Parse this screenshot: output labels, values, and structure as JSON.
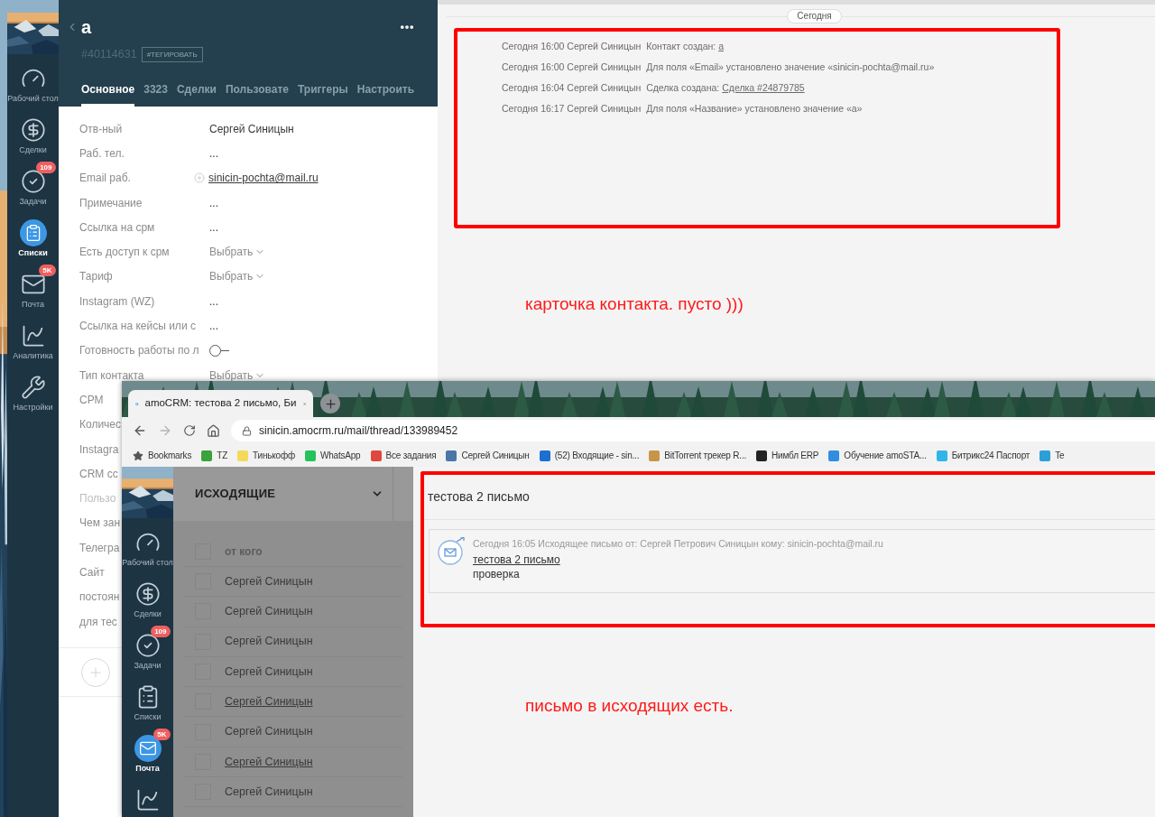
{
  "sidebar": {
    "items": [
      {
        "label": "Рабочий стол",
        "selected": false
      },
      {
        "label": "Сделки",
        "selected": false
      },
      {
        "label": "Задачи",
        "badge": "109",
        "selected": false
      },
      {
        "label": "Списки",
        "selected": true
      },
      {
        "label": "Почта",
        "badge": "5K",
        "selected": false
      },
      {
        "label": "Аналитика",
        "selected": false
      },
      {
        "label": "Настройки",
        "selected": false
      }
    ]
  },
  "contact": {
    "title": "a",
    "id": "#40114631",
    "tag_button": "#ТЕГИРОВАТЬ",
    "tabs": [
      {
        "label": "Основное",
        "selected": true
      },
      {
        "label": "3323",
        "selected": false
      },
      {
        "label": "Сделки",
        "selected": false
      },
      {
        "label": "Пользовате",
        "selected": false
      },
      {
        "label": "Триггеры",
        "selected": false
      },
      {
        "label": "Настроить",
        "selected": false
      }
    ],
    "fields": [
      {
        "label": "Отв-ный",
        "kind": "text",
        "value": "Сергей Синицын",
        "muted": false
      },
      {
        "label": "Раб. тел.",
        "kind": "text",
        "value": "...",
        "muted": false
      },
      {
        "label": "Email раб.",
        "kind": "email",
        "value": "sinicin-pochta@mail.ru",
        "muted": false
      },
      {
        "label": "Примечание",
        "kind": "text",
        "value": "...",
        "muted": false
      },
      {
        "label": "Ссылка на срм",
        "kind": "text",
        "value": "...",
        "muted": false
      },
      {
        "label": "Есть доступ к срм",
        "kind": "select",
        "placeholder": "Выбрать",
        "muted": false
      },
      {
        "label": "Тариф",
        "kind": "select",
        "placeholder": "Выбрать",
        "muted": false
      },
      {
        "label": "Instagram (WZ)",
        "kind": "text",
        "value": "...",
        "muted": false
      },
      {
        "label": "Ссылка на кейсы или с",
        "kind": "text",
        "value": "...",
        "muted": false
      },
      {
        "label": "Готовность работы по л",
        "kind": "toggle",
        "on": false,
        "muted": false
      },
      {
        "label": "Тип контакта",
        "kind": "select",
        "placeholder": "Выбрать",
        "muted": false
      },
      {
        "label": "СРМ",
        "kind": "covered",
        "muted": false
      },
      {
        "label": "Количес",
        "kind": "covered",
        "muted": false
      },
      {
        "label": "Instagra",
        "kind": "covered",
        "muted": false
      },
      {
        "label": "CRM сс",
        "kind": "covered",
        "muted": false
      },
      {
        "label": "Пользо",
        "kind": "covered",
        "muted": true
      },
      {
        "label": "Чем зан",
        "kind": "covered",
        "muted": false
      },
      {
        "label": "Телегра",
        "kind": "covered",
        "muted": false
      },
      {
        "label": "Сайт",
        "kind": "covered",
        "muted": false
      },
      {
        "label": "постоян",
        "kind": "covered",
        "muted": false
      },
      {
        "label": "для тес",
        "kind": "covered",
        "muted": false
      }
    ]
  },
  "timeline": {
    "date": "Сегодня",
    "events": [
      {
        "meta": "Сегодня 16:00 Сергей Синицын",
        "text": "Контакт создан:",
        "link": "a"
      },
      {
        "meta": "Сегодня 16:00 Сергей Синицын",
        "text": "Для поля «Email» установлено значение «sinicin-pochta@mail.ru»"
      },
      {
        "meta": "Сегодня 16:04 Сергей Синицын",
        "text": "Сделка создана:",
        "link": "Сделка #24879785"
      },
      {
        "meta": "Сегодня 16:17 Сергей Синицын",
        "text": "Для поля «Название» установлено значение «a»"
      }
    ],
    "note": "карточка контакта. пусто )))"
  },
  "browser": {
    "tab_title": "amoCRM: тестова 2 письмо, Би",
    "url": "sinicin.amocrm.ru/mail/thread/133989452",
    "bookmarks": [
      {
        "label": "Bookmarks",
        "kind": "star"
      },
      {
        "label": "TZ",
        "kind": "favicon",
        "color": "#3aa33a"
      },
      {
        "label": "Тинькофф",
        "kind": "favicon",
        "color": "#f5d95a"
      },
      {
        "label": "WhatsApp",
        "kind": "favicon",
        "color": "#25c15a"
      },
      {
        "label": "Все задания",
        "kind": "favicon",
        "color": "#e0483e"
      },
      {
        "label": "Сергей Синицын",
        "kind": "favicon",
        "color": "#4a76a8"
      },
      {
        "label": "(52) Входящие - sin...",
        "kind": "favicon",
        "color": "#1e6fd0"
      },
      {
        "label": "BitTorrent трекер R...",
        "kind": "favicon",
        "color": "#c8944a"
      },
      {
        "label": "Нимбл ERP",
        "kind": "favicon",
        "color": "#222222"
      },
      {
        "label": "Обучение amoSTA...",
        "kind": "favicon",
        "color": "#2f8ee0"
      },
      {
        "label": "Битрикс24 Паспорт",
        "kind": "favicon",
        "color": "#2fb5e8"
      },
      {
        "label": "Te",
        "kind": "favicon",
        "color": "#2a9fd8"
      }
    ],
    "sidebar": {
      "items": [
        {
          "label": "Рабочий стол",
          "selected": false
        },
        {
          "label": "Сделки",
          "selected": false
        },
        {
          "label": "Задачи",
          "badge": "109",
          "selected": false
        },
        {
          "label": "Списки",
          "selected": false
        },
        {
          "label": "Почта",
          "badge": "5K",
          "selected": true
        },
        {
          "selected": false
        }
      ]
    },
    "mail_list": {
      "folder": "ИСХОДЯЩИЕ",
      "column": "от кого",
      "all_checked": false,
      "rows": [
        {
          "sender": "Сергей Синицын",
          "underlined": false,
          "checked": false
        },
        {
          "sender": "Сергей Синицын",
          "underlined": false,
          "checked": false
        },
        {
          "sender": "Сергей Синицын",
          "underlined": false,
          "checked": false
        },
        {
          "sender": "Сергей Синицын",
          "underlined": false,
          "checked": false
        },
        {
          "sender": "Сергей Синицын",
          "underlined": true,
          "checked": false
        },
        {
          "sender": "Сергей Синицын",
          "underlined": false,
          "checked": false
        },
        {
          "sender": "Сергей Синицын",
          "underlined": true,
          "checked": false
        },
        {
          "sender": "Сергей Синицын",
          "underlined": false,
          "checked": false
        }
      ]
    },
    "thread": {
      "subject": "тестова 2 письмо",
      "message": {
        "meta": "Сегодня 16:05 Исходящее письмо от: Сергей Петрович Синицын кому: sinicin-pochta@mail.ru",
        "subject": "тестова 2 письмо",
        "body": "проверка"
      }
    },
    "note": "письмо в исходящих есть."
  }
}
